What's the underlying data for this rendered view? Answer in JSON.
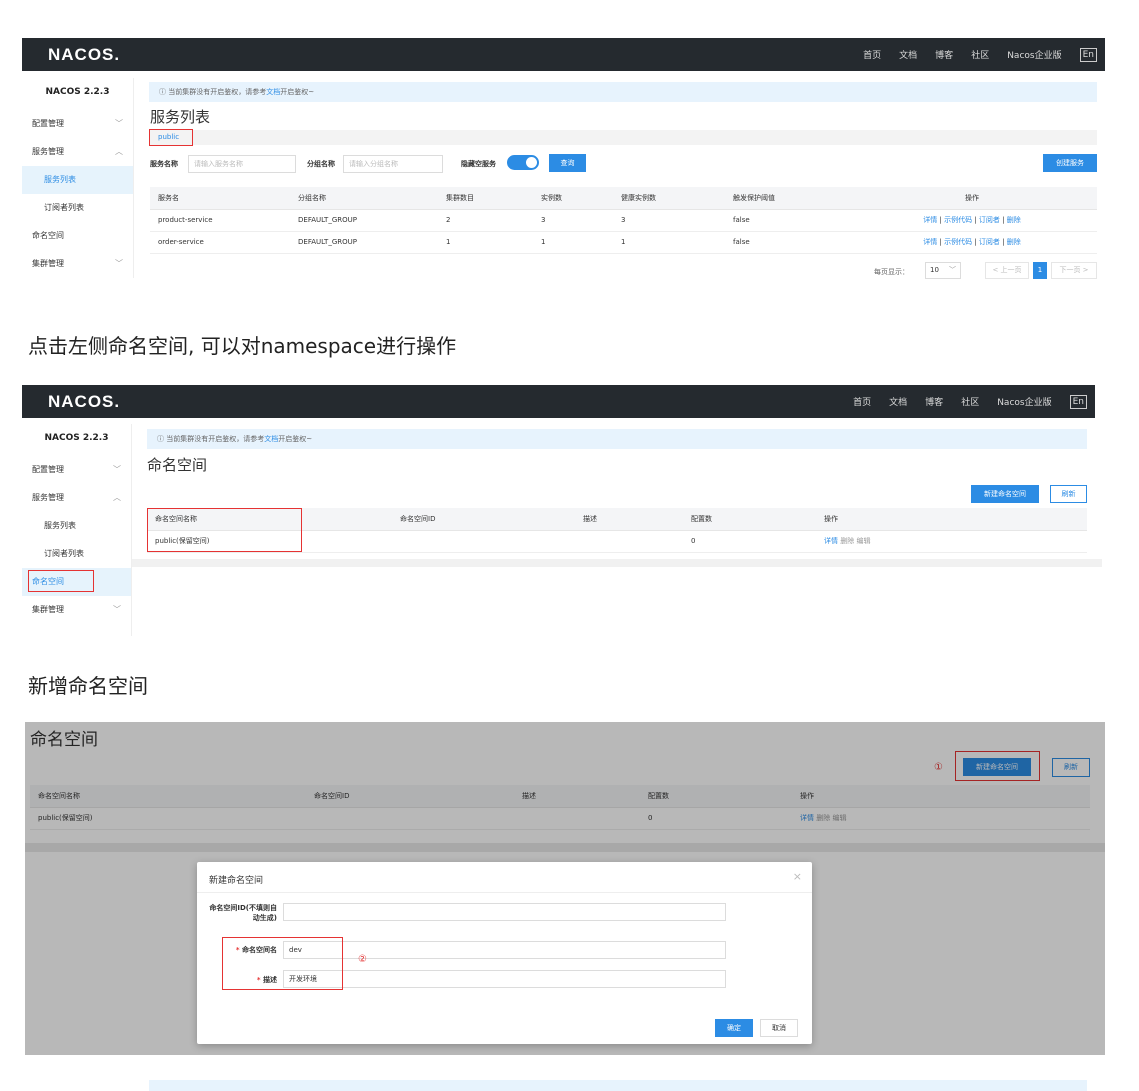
{
  "brand": "NACOS.",
  "nav_links": [
    "首页",
    "文档",
    "博客",
    "社区",
    "Nacos企业版"
  ],
  "nav_lang": "En",
  "version": "NACOS 2.2.3",
  "sidebar": {
    "config": "配置管理",
    "service": "服务管理",
    "service_list": "服务列表",
    "subscriber_list": "订阅者列表",
    "namespace": "命名空间",
    "cluster": "集群管理"
  },
  "notice": {
    "prefix": "ⓘ 当前集群没有开启鉴权，请参考",
    "link": "文档",
    "suffix": "开启鉴权~"
  },
  "panel1": {
    "title": "服务列表",
    "ns_tab": "public",
    "service_name_label": "服务名称",
    "service_name_placeholder": "请输入服务名称",
    "group_label": "分组名称",
    "group_placeholder": "请输入分组名称",
    "hide_empty_label": "隐藏空服务",
    "query_btn": "查询",
    "create_btn": "创建服务",
    "columns": [
      "服务名",
      "分组名称",
      "集群数目",
      "实例数",
      "健康实例数",
      "触发保护阈值",
      "操作"
    ],
    "rows": [
      [
        "product-service",
        "DEFAULT_GROUP",
        "2",
        "3",
        "3",
        "false"
      ],
      [
        "order-service",
        "DEFAULT_GROUP",
        "1",
        "1",
        "1",
        "false"
      ]
    ],
    "actions": {
      "detail": "详情",
      "sample": "示例代码",
      "subscriber": "订阅者",
      "delete": "删除"
    },
    "page_size_label": "每页显示：",
    "page_size": "10",
    "prev": "< 上一页",
    "page": "1",
    "next": "下一页 >"
  },
  "caption1": "点击左侧命名空间, 可以对namespace进行操作",
  "panel2": {
    "title": "命名空间",
    "new_btn": "新建命名空间",
    "refresh_btn": "刷新",
    "columns": [
      "命名空间名称",
      "命名空间ID",
      "描述",
      "配置数",
      "操作"
    ],
    "row": {
      "name": "public(保留空间)",
      "id": "",
      "desc": "",
      "count": "0"
    },
    "actions": {
      "detail": "详情",
      "delete": "删除",
      "edit": "编辑"
    }
  },
  "caption2": "新增命名空间",
  "panel3": {
    "title": "命名空间",
    "step1": "①",
    "step2": "②",
    "modal_title": "新建命名空间",
    "close": "×",
    "id_label": "命名空间ID(不填则自动生成)",
    "name_label": "命名空间名",
    "name_value": "dev",
    "desc_label": "描述",
    "desc_value": "开发环境",
    "required": "*",
    "ok": "确定",
    "cancel": "取消"
  }
}
